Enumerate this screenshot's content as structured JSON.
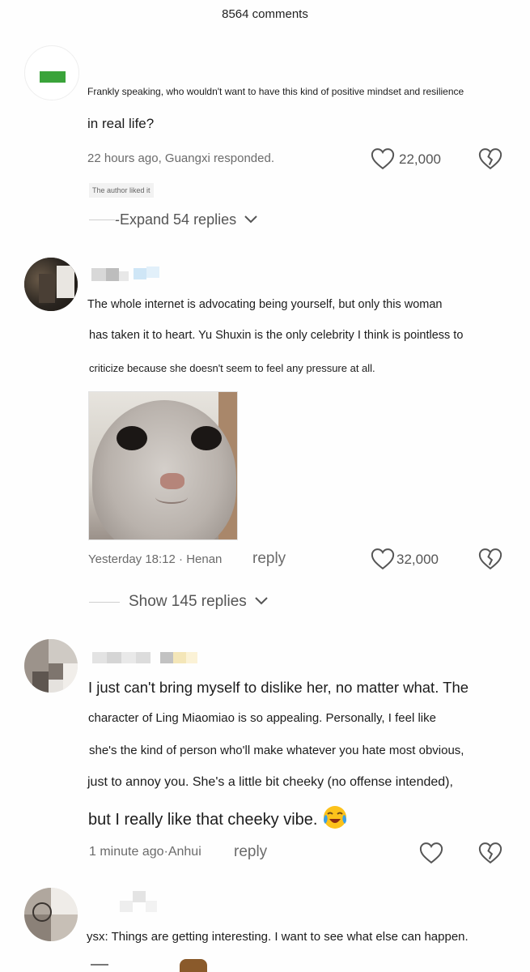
{
  "header": {
    "comment_count": "8564 comments"
  },
  "comments": [
    {
      "lines": [
        "Frankly speaking, who wouldn't want to have this kind of positive mindset and resilience",
        "in real life?"
      ],
      "meta": "22 hours ago, Guangxi responded.",
      "likes": "22,000",
      "badge": "The author liked it",
      "expand": "-Expand 54 replies"
    },
    {
      "lines": [
        "The whole internet is advocating being yourself, but only this woman",
        "has taken it to heart. Yu Shuxin is the only celebrity I think is pointless to",
        "criticize because she doesn't seem to feel any pressure at all."
      ],
      "meta": "Yesterday 18:12 · Henan",
      "reply": "reply",
      "likes": "32,000",
      "expand": "Show 145 replies"
    },
    {
      "lines": [
        "I just can't bring myself to dislike her, no matter what. The",
        "character of Ling Miaomiao is so appealing. Personally, I feel like",
        "she's the kind of person who'll make whatever you hate most obvious,",
        "just to annoy you. She's a little bit cheeky (no offense intended),",
        "but I really like that cheeky vibe."
      ],
      "meta": "1 minute ago·Anhui",
      "reply": "reply"
    },
    {
      "lines": [
        "ysx: Things are getting interesting. I want to see what else can happen."
      ]
    }
  ],
  "icons": {
    "like": "heart-outline-icon",
    "dislike": "broken-heart-icon",
    "expand": "chevron-down-icon",
    "emoji": "crying-laughing-emoji"
  },
  "colors": {
    "accent_green": "#3aa33a",
    "text": "#1c1c1c",
    "meta": "#6b6b6b",
    "icon": "#555555"
  }
}
